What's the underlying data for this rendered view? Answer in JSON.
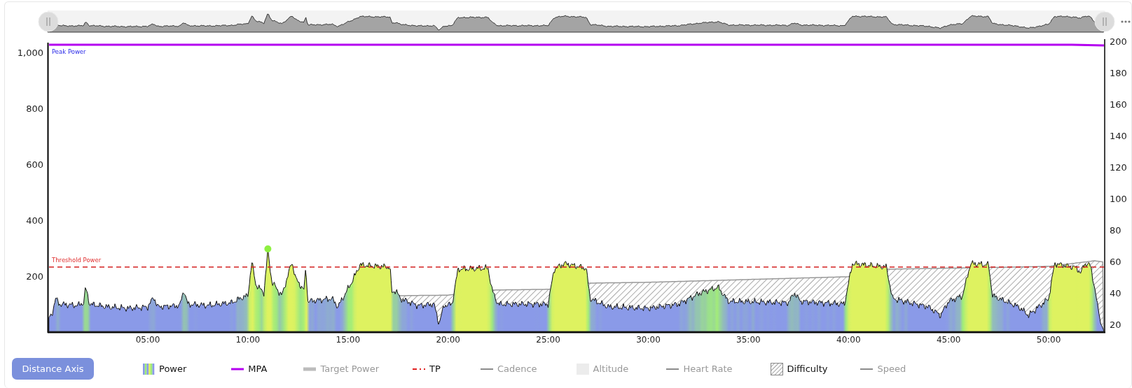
{
  "chart": {
    "left_ticks": [
      "1,000",
      "800",
      "600",
      "400",
      "200"
    ],
    "right_ticks": [
      "200",
      "180",
      "160",
      "140",
      "120",
      "100",
      "80",
      "60",
      "40",
      "20"
    ],
    "x_ticks": [
      "05:00",
      "10:00",
      "15:00",
      "20:00",
      "25:00",
      "30:00",
      "35:00",
      "40:00",
      "45:00",
      "50:00"
    ],
    "annotations": [
      {
        "kind": "peak",
        "label": "Peak Power"
      },
      {
        "kind": "threshold",
        "label": "Threshold Power"
      }
    ]
  },
  "distance_button": {
    "label": "Distance Axis"
  },
  "legend": [
    {
      "kind": "gradient",
      "label": "Power",
      "on": true
    },
    {
      "kind": "line",
      "label": "MPA",
      "on": true,
      "color": "#b400f0"
    },
    {
      "kind": "thick",
      "label": "Target Power",
      "on": false,
      "color": "#bcbcbc"
    },
    {
      "kind": "dash",
      "label": "TP",
      "on": true,
      "color": "#e02020"
    },
    {
      "kind": "line",
      "label": "Cadence",
      "on": false,
      "color": "#8c8c8c"
    },
    {
      "kind": "box",
      "label": "Altitude",
      "on": false,
      "color": "#ececec"
    },
    {
      "kind": "line",
      "label": "Heart Rate",
      "on": false,
      "color": "#8c8c8c"
    },
    {
      "kind": "hatch",
      "label": "Difficulty",
      "on": true
    },
    {
      "kind": "line",
      "label": "Speed",
      "on": false,
      "color": "#8c8c8c"
    }
  ]
}
